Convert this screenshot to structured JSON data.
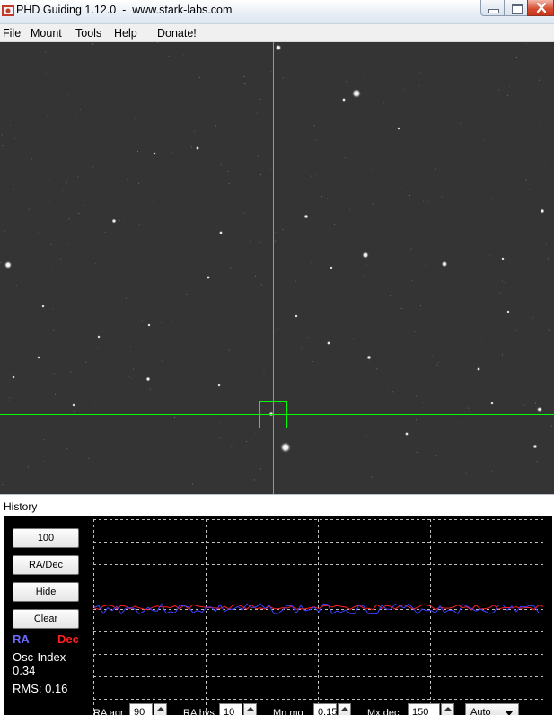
{
  "window": {
    "title": "PHD Guiding 1.12.0  -  www.stark-labs.com"
  },
  "menu": {
    "items": [
      "File",
      "Mount",
      "Tools",
      "Help",
      "Donate!"
    ]
  },
  "history": {
    "title": "History",
    "buttons": {
      "length": "100",
      "mode": "RA/Dec",
      "hide": "Hide",
      "clear": "Clear"
    },
    "legend": {
      "ra": "RA",
      "dec": "Dec"
    },
    "osc_label": "Osc-Index",
    "osc_value": "0.34",
    "rms_label": "RMS: 0.16",
    "controls": {
      "ra_aggr_label": "RA agr",
      "ra_aggr_value": "90",
      "ra_hys_label": "RA hys",
      "ra_hys_value": "10",
      "min_mo_label": "Mn mo",
      "min_mo_value": "0.15",
      "max_dec_label": "Mx dec",
      "max_dec_value": "150",
      "dec_mode": "Auto"
    }
  },
  "colors": {
    "crosshair": "#00ff00",
    "ra_trace": "#4040ff",
    "dec_trace": "#ff2020",
    "grid": "#bfbfbf"
  }
}
